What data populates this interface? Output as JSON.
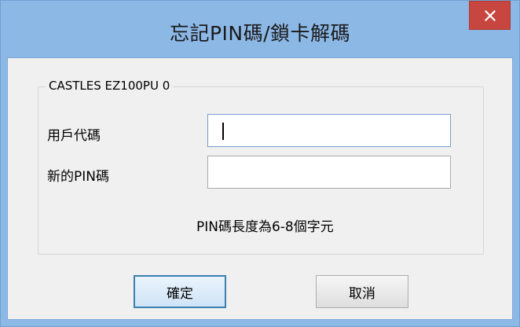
{
  "window": {
    "title": "忘記PIN碼/鎖卡解碼",
    "close_glyph": "✕"
  },
  "group": {
    "legend": "CASTLES EZ100PU 0"
  },
  "fields": {
    "user_code_label": "用戶代碼",
    "user_code_value": "",
    "new_pin_label": "新的PIN碼",
    "new_pin_value": ""
  },
  "hint": "PIN碼長度為6-8個字元",
  "buttons": {
    "ok_label": "確定",
    "cancel_label": "取消"
  },
  "colors": {
    "titlebar": "#8cb8e6",
    "close_button": "#c7463f",
    "client_background": "#f0f0f0"
  },
  "icons": {
    "close": "close-icon"
  }
}
